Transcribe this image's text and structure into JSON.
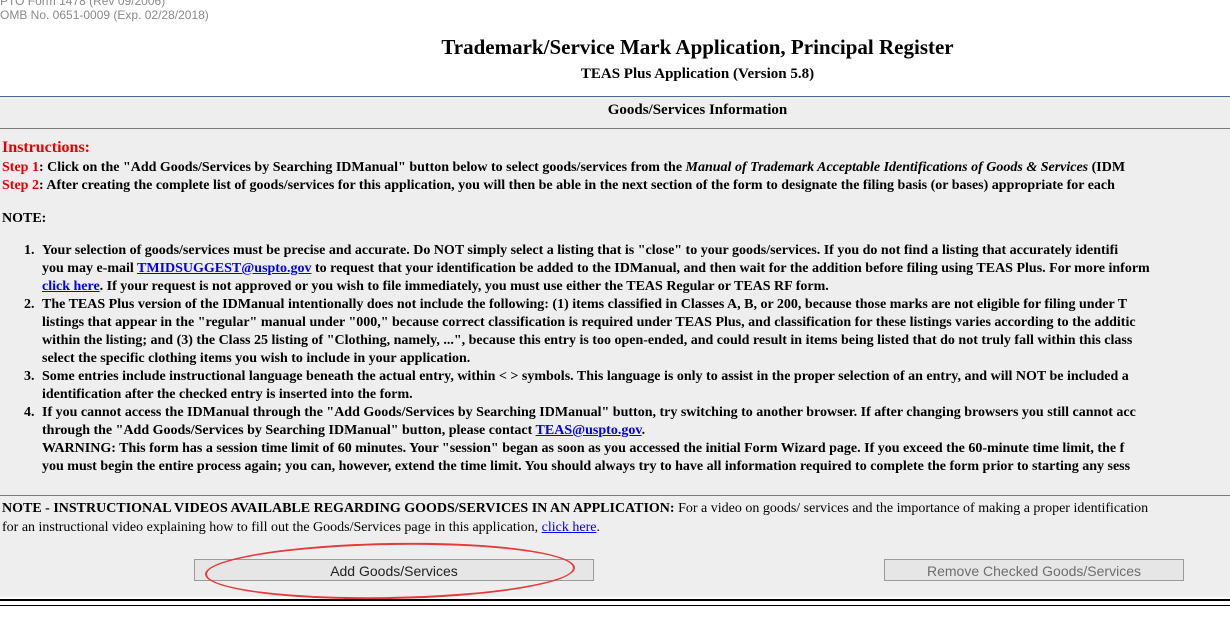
{
  "form_meta": {
    "line1": "PTO Form 1478 (Rev 09/2006)",
    "line2": "OMB No. 0651-0009 (Exp. 02/28/2018)"
  },
  "header": {
    "title": "Trademark/Service Mark Application, Principal Register",
    "subtitle": "TEAS Plus Application (Version 5.8)"
  },
  "section": {
    "title": "Goods/Services Information"
  },
  "instructions": {
    "heading": "Instructions:",
    "step1": {
      "label": "Step 1",
      "text_a": ": Click on the \"Add Goods/Services by Searching IDManual\" button below to select goods/services from the ",
      "text_italic": "Manual of Trademark Acceptable Identifications of Goods & Services",
      "text_b": " (IDM"
    },
    "step2": {
      "label": "Step 2",
      "text": ": After creating the complete list of goods/services for this application, you will then be able in the next section of the form to designate the filing basis (or bases) appropriate for each"
    }
  },
  "note": {
    "heading": "NOTE:",
    "items": [
      {
        "num": "1.",
        "l1": "Your selection of goods/services must be precise and accurate. Do NOT simply select a listing that is \"close\" to your goods/services. If you do not find a listing that accurately identifi",
        "l2a": "you may e-mail ",
        "l2_link": "TMIDSUGGEST@uspto.gov",
        "l2b": " to request that your identification be added to the IDManual, and then wait for the addition before filing using TEAS Plus. For more inform",
        "l3_link": "click here",
        "l3b": ". If your request is not approved or you wish to file immediately, you must use either the TEAS Regular or TEAS RF form."
      },
      {
        "num": "2.",
        "l1": "The TEAS Plus version of the IDManual intentionally does not include the following: (1) items classified in Classes A, B, or 200, because those marks are not eligible for filing under T",
        "l2": "listings that appear in the \"regular\" manual under \"000,\" because correct classification is required under TEAS Plus, and classification for these listings varies according to the additic",
        "l3": "within the listing; and (3) the Class 25 listing of \"Clothing, namely, ...\", because this entry is too open-ended, and could result in items being listed that do not truly fall within this class",
        "l4": "select the specific clothing items you wish to include in your application."
      },
      {
        "num": "3.",
        "l1": "Some entries include instructional language beneath the actual entry, within < > symbols. This language is only to assist in the proper selection of an entry, and will NOT be included a",
        "l2": "identification after the checked entry is inserted into the form."
      },
      {
        "num": "4.",
        "l1": "If you cannot access the IDManual through the \"Add Goods/Services by Searching IDManual\" button, try switching to another browser. If after changing browsers you still cannot acc",
        "l2a": "through the \"Add Goods/Services by Searching IDManual\" button, please contact ",
        "l2_link": "TEAS@uspto.gov",
        "l2b": ".",
        "l3": "WARNING: This form has a session time limit of 60 minutes. Your \"session\" began as soon as you accessed the initial Form Wizard page. If you exceed the 60-minute time limit, the f",
        "l4": "you must begin the entire process again; you can, however, extend the time limit. You should always try to have all information required to complete the form prior to starting any sess"
      }
    ]
  },
  "videos": {
    "bold": "NOTE - INSTRUCTIONAL VIDEOS AVAILABLE REGARDING GOODS/SERVICES IN AN APPLICATION:",
    "rest": " For a video on goods/ services and the importance of making a proper identification",
    "line2": "for an instructional video explaining how to fill out the Goods/Services page in this application, ",
    "line2_link": "click here",
    "line2_end": "."
  },
  "buttons": {
    "add": "Add Goods/Services",
    "remove": "Remove Checked Goods/Services"
  },
  "colors": {
    "instruction_red": "#e50000",
    "link_blue": "#0000ee",
    "panel_gray": "#eeeeee",
    "annotation_oval": "#e53a3a"
  }
}
